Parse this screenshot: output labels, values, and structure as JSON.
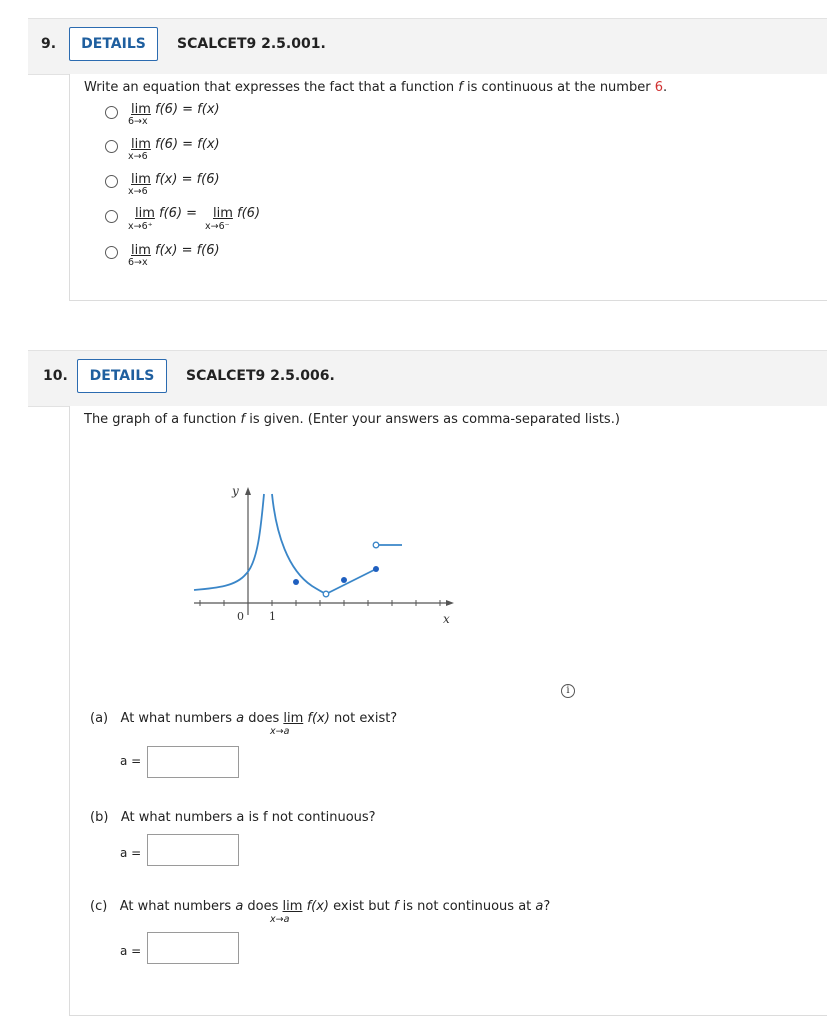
{
  "q9": {
    "number": "9.",
    "details_label": "DETAILS",
    "code": "SCALCET9 2.5.001.",
    "prompt_prefix": "Write an equation that expresses the fact that a function ",
    "prompt_f": "f",
    "prompt_mid": " is continuous at the number ",
    "prompt_number": "6",
    "prompt_end": ".",
    "options": [
      {
        "lim_word": "lim",
        "expr": "f(6) = f(x)",
        "sub": "6→x"
      },
      {
        "lim_word": "lim",
        "expr": "f(6) = f(x)",
        "sub": "x→6"
      },
      {
        "lim_word": "lim",
        "expr": "f(x) = f(6)",
        "sub": "x→6"
      },
      {
        "lim_word": "lim",
        "expr": "f(6)  =",
        "sub": "x→6⁺",
        "lim_word2": "lim",
        "expr2": "f(6)",
        "sub2": "x→6⁻"
      },
      {
        "lim_word": "lim",
        "expr": "f(x) = f(6)",
        "sub": "6→x"
      }
    ]
  },
  "q10": {
    "number": "10.",
    "details_label": "DETAILS",
    "code": "SCALCET9 2.5.006.",
    "prompt_prefix": "The graph of a function ",
    "prompt_f": "f",
    "prompt_rest": " is given. (Enter your answers as comma-separated lists.)",
    "graph": {
      "y_label": "y",
      "x_label": "x",
      "tick_0": "0",
      "tick_1": "1",
      "curve_color": "#3a86c8",
      "dot_color": "#1f5fbf"
    },
    "info_icon": "info-icon",
    "parts": [
      {
        "tag": "(a)",
        "pre": "At what numbers ",
        "a": "a",
        "mid": " does ",
        "lim_word": "lim",
        "lim_expr": "f(x)",
        "lim_sub": "x→a",
        "post": " not exist?",
        "answer_label": "a =",
        "answer_value": ""
      },
      {
        "tag": "(b)",
        "text": "At what numbers a is f not continuous?",
        "answer_label": "a =",
        "answer_value": ""
      },
      {
        "tag": "(c)",
        "pre": "At what numbers ",
        "a": "a",
        "mid": " does ",
        "lim_word": "lim",
        "lim_expr": "f(x)",
        "lim_sub": "x→a",
        "post_pre": " exist but ",
        "post_f": "f",
        "post_mid": " is not continuous at ",
        "post_a": "a",
        "post_end": "?",
        "answer_label": "a =",
        "answer_value": ""
      }
    ]
  }
}
